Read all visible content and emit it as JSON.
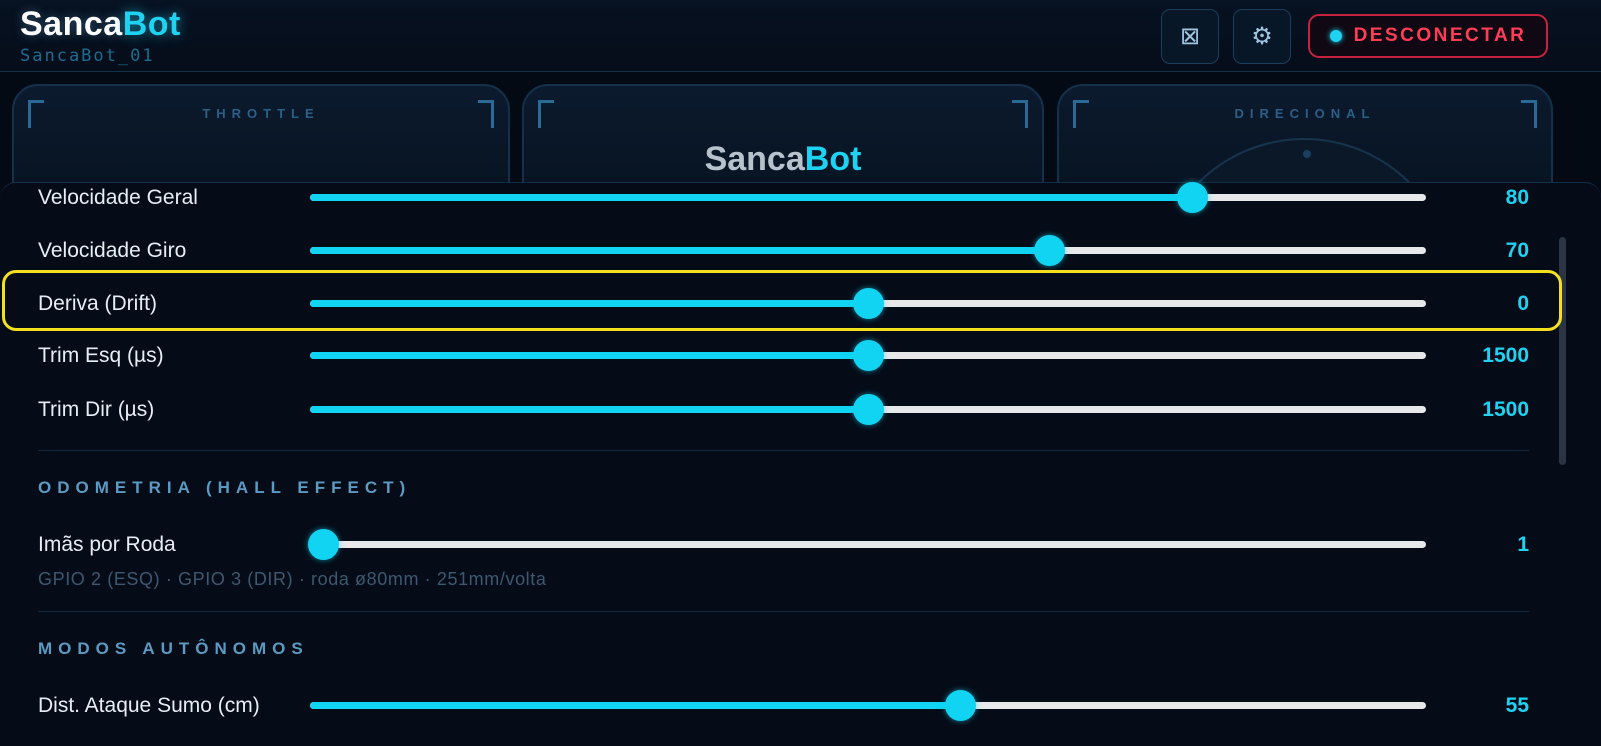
{
  "header": {
    "brand_part1": "Sanca",
    "brand_part2": "Bot",
    "device_name": "SancaBot_01",
    "icon_btn_1": "⊠",
    "icon_btn_1_name": "close-box-icon",
    "icon_btn_2": "⚙",
    "icon_btn_2_name": "gear-icon",
    "disconnect_label": "DESCONECTAR"
  },
  "panels": {
    "throttle_label": "THROTTLE",
    "logo_part1": "Sanca",
    "logo_part2": "Bot",
    "directional_label": "DIRECIONAL"
  },
  "settings": {
    "sliders": [
      {
        "label": "Velocidade Geral",
        "value": "80",
        "fraction": 0.79
      },
      {
        "label": "Velocidade Giro",
        "value": "70",
        "fraction": 0.662
      },
      {
        "label": "Deriva (Drift)",
        "value": "0",
        "fraction": 0.5
      },
      {
        "label": "Trim Esq (µs)",
        "value": "1500",
        "fraction": 0.5
      },
      {
        "label": "Trim Dir (µs)",
        "value": "1500",
        "fraction": 0.5
      }
    ],
    "odometry": {
      "title": "ODOMETRIA (HALL EFFECT)",
      "slider": {
        "label": "Imãs por Roda",
        "value": "1",
        "fraction": 0.012
      },
      "hint": "GPIO 2 (ESQ) · GPIO 3 (DIR) · roda ø80mm · 251mm/volta"
    },
    "autonomous": {
      "title": "MODOS AUTÔNOMOS",
      "slider": {
        "label": "Dist. Ataque Sumo (cm)",
        "value": "55",
        "fraction": 0.582
      }
    }
  },
  "colors": {
    "accent": "#1ed2f2",
    "danger": "#ff3d57",
    "highlight": "#f4e01d",
    "background": "#050c18"
  }
}
